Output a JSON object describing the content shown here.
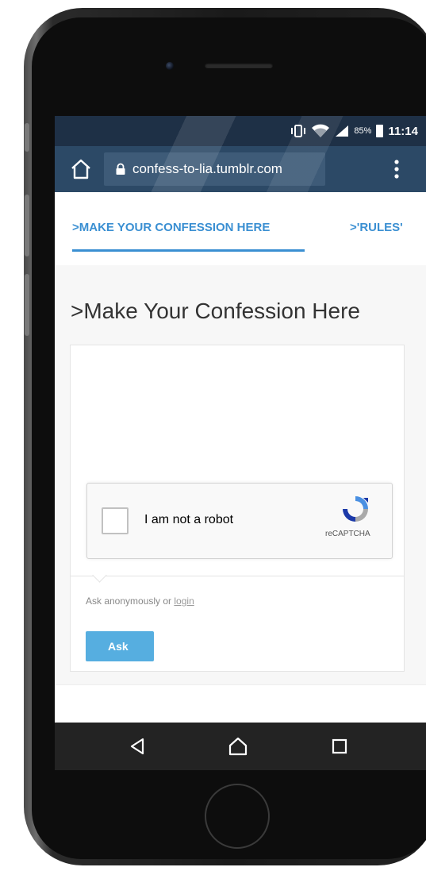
{
  "status_bar": {
    "battery_percent": "85%",
    "time": "11:14",
    "icons": [
      "vibrate-icon",
      "wifi-icon",
      "signal-icon",
      "battery-icon"
    ]
  },
  "browser": {
    "url": "confess-to-lia.tumblr.com",
    "icons": [
      "home-icon",
      "lock-icon",
      "more-vert-icon"
    ]
  },
  "tabs": [
    {
      "label": ">MAKE YOUR CONFESSION HERE",
      "active": true
    },
    {
      "label": ">'RULES'",
      "active": false
    }
  ],
  "page": {
    "title": ">Make Your Confession Here"
  },
  "recaptcha": {
    "checkbox_label": "I am not a robot",
    "brand": "reCAPTCHA"
  },
  "form": {
    "anon_prefix": "Ask anonymously or ",
    "login_label": "login",
    "ask_button": "Ask"
  },
  "nav_bar": {
    "icons": [
      "back-icon",
      "home-icon",
      "recents-icon"
    ]
  },
  "colors": {
    "status_bar": "#1e3046",
    "toolbar": "#2c4966",
    "accent": "#3a8fd2",
    "ask_button": "#56aee0"
  }
}
